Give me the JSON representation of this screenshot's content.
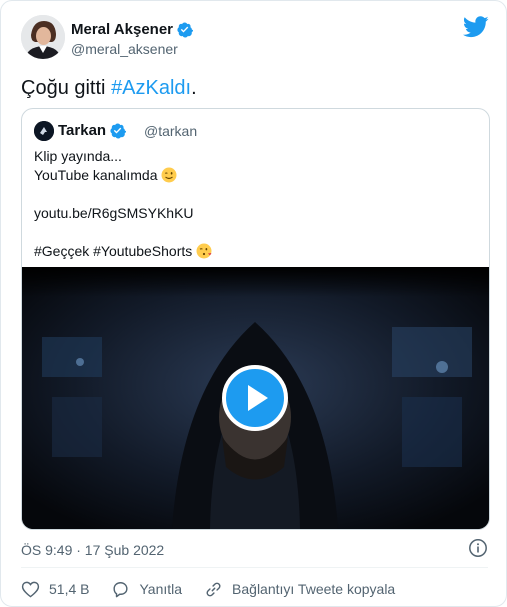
{
  "tweet": {
    "author_name": "Meral Akşener",
    "author_handle": "@meral_aksener",
    "text_plain": "Çoğu gitti ",
    "text_hashtag": "#AzKaldı",
    "text_end": ".",
    "timestamp": "ÖS 9:49 · 17 Şub 2022"
  },
  "quoted": {
    "author_name": "Tarkan",
    "author_handle": "@tarkan",
    "line1": "Klip yayında...",
    "line2": "YouTube kanalımda",
    "line3": "youtu.be/R6gSMSYKhKU",
    "line4": "#Geççek #YoutubeShorts"
  },
  "actions": {
    "likes": "51,4 B",
    "reply": "Yanıtla",
    "copy_link": "Bağlantıyı Tweete kopyala"
  },
  "colors": {
    "accent": "#1d9bf0",
    "text": "#0f1419",
    "muted": "#536471"
  },
  "icons": [
    "verified-icon",
    "twitter-logo-icon",
    "play-icon",
    "info-icon",
    "heart-icon",
    "reply-icon",
    "link-icon"
  ]
}
